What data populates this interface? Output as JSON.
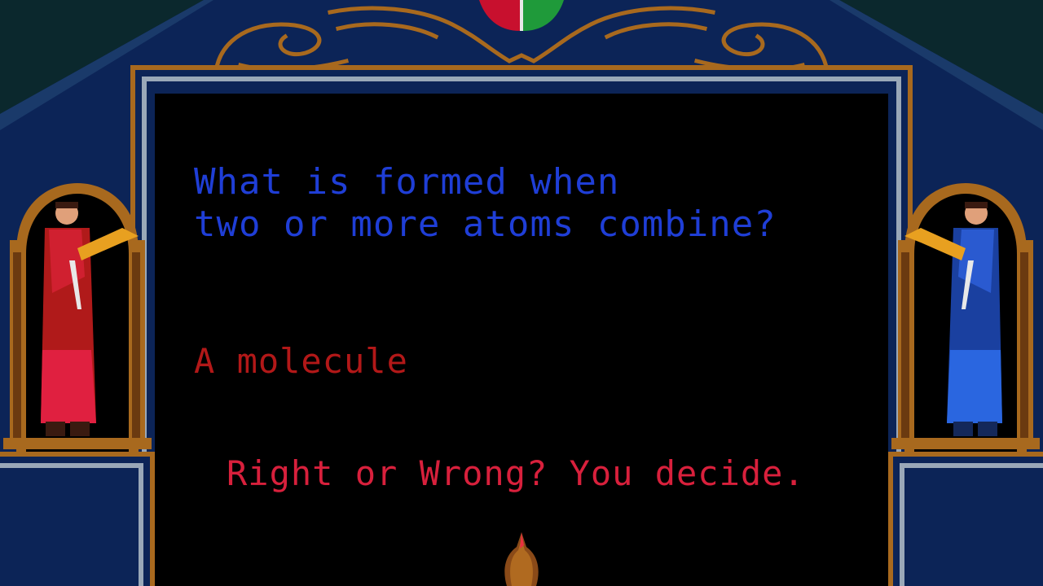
{
  "quiz": {
    "question": "What is formed when\ntwo or more atoms combine?",
    "answer": "A molecule",
    "prompt": "Right or Wrong? You decide."
  },
  "colors": {
    "question": "#1f3ed6",
    "answer": "#b21818",
    "prompt": "#d8203c",
    "frame_blue": "#0c2457",
    "gold": "#a8691e",
    "screen": "#000000"
  },
  "characters": {
    "left": "red-robed-herald-icon",
    "right": "blue-robed-herald-icon"
  }
}
